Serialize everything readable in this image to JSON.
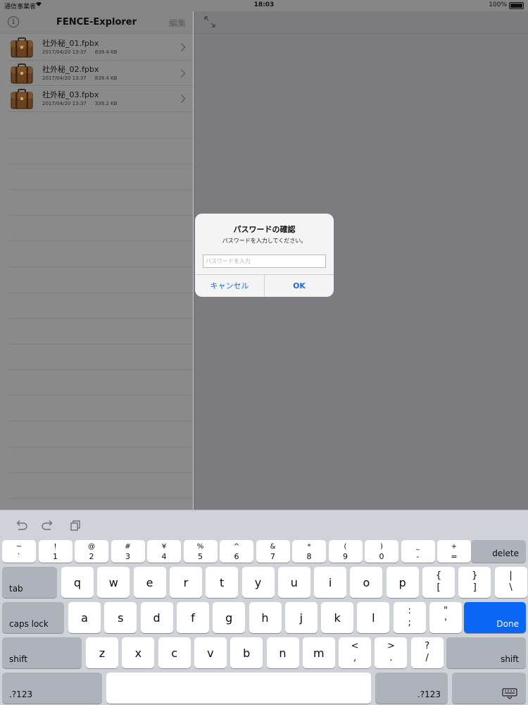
{
  "status": {
    "carrier": "通信事業者",
    "time": "18:03",
    "battery": "100%"
  },
  "master": {
    "title": "FENCE-Explorer",
    "edit_label": "編集",
    "info_label": "i",
    "files": [
      {
        "name": "社外秘_01.fpbx",
        "date": "2017/04/20 13:37",
        "size": "839.4 KB"
      },
      {
        "name": "社外秘_02.fpbx",
        "date": "2017/04/20 13:37",
        "size": "839.4 KB"
      },
      {
        "name": "社外秘_03.fpbx",
        "date": "2017/04/20 13:37",
        "size": "339.2 KB"
      }
    ]
  },
  "alert": {
    "title": "パスワードの確認",
    "message": "パスワードを入力してください。",
    "placeholder": "パスワードを入力",
    "cancel": "キャンセル",
    "ok": "OK"
  },
  "keyboard": {
    "number_row": [
      {
        "top": "~",
        "bot": "`"
      },
      {
        "top": "!",
        "bot": "1"
      },
      {
        "top": "@",
        "bot": "2"
      },
      {
        "top": "#",
        "bot": "3"
      },
      {
        "top": "¥",
        "bot": "4"
      },
      {
        "top": "%",
        "bot": "5"
      },
      {
        "top": "^",
        "bot": "6"
      },
      {
        "top": "&",
        "bot": "7"
      },
      {
        "top": "*",
        "bot": "8"
      },
      {
        "top": "(",
        "bot": "9"
      },
      {
        "top": ")",
        "bot": "0"
      },
      {
        "top": "_",
        "bot": "-"
      },
      {
        "top": "+",
        "bot": "="
      }
    ],
    "delete": "delete",
    "tab": "tab",
    "row_q": [
      "q",
      "w",
      "e",
      "r",
      "t",
      "y",
      "u",
      "i",
      "o",
      "p"
    ],
    "row_q_extra": [
      {
        "top": "{",
        "bot": "["
      },
      {
        "top": "}",
        "bot": "]"
      },
      {
        "top": "|",
        "bot": "\\"
      }
    ],
    "caps_lock": "caps lock",
    "row_a": [
      "a",
      "s",
      "d",
      "f",
      "g",
      "h",
      "j",
      "k",
      "l"
    ],
    "row_a_extra": [
      {
        "top": ":",
        "bot": ";"
      },
      {
        "top": "\"",
        "bot": "'"
      }
    ],
    "done": "Done",
    "shift": "shift",
    "row_z": [
      "z",
      "x",
      "c",
      "v",
      "b",
      "n",
      "m"
    ],
    "row_z_extra": [
      {
        "top": "<",
        "bot": ","
      },
      {
        "top": ">",
        "bot": "."
      },
      {
        "top": "?",
        "bot": "/"
      }
    ],
    "mode": ".?123"
  }
}
